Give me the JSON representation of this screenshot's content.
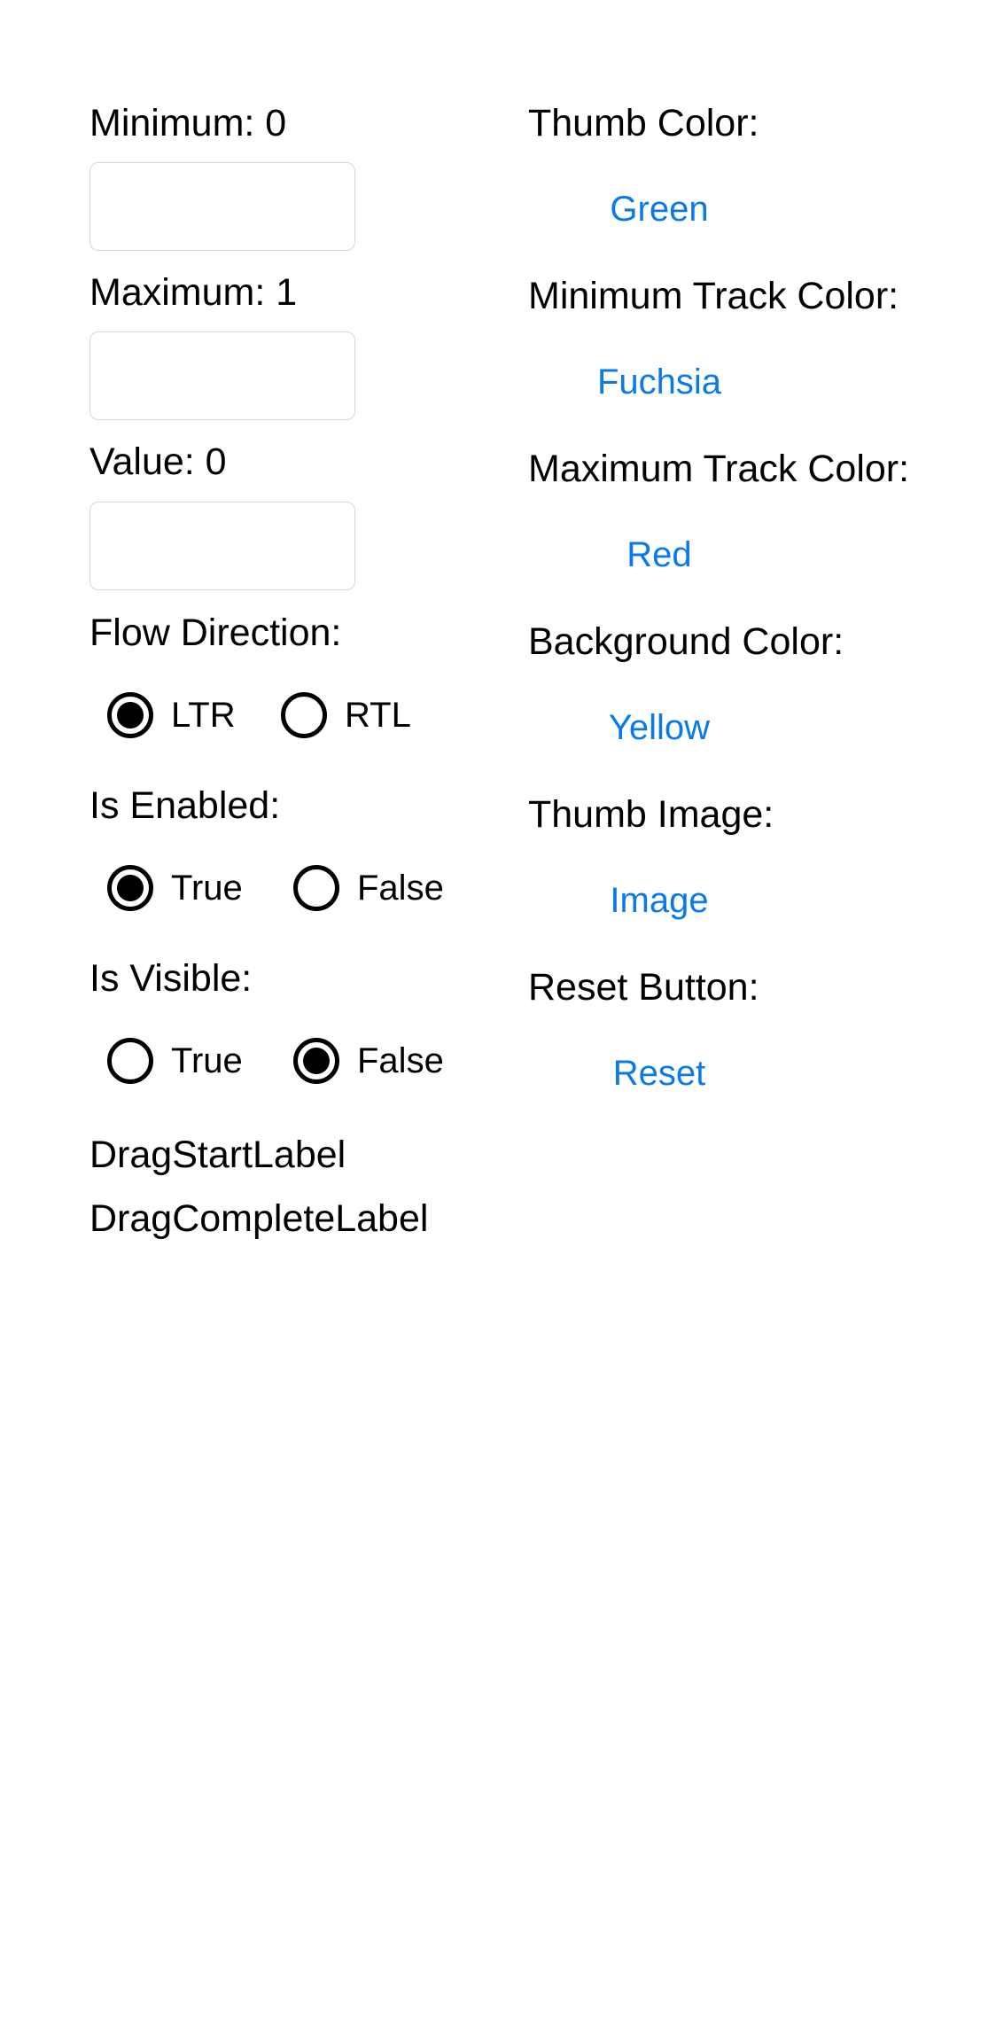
{
  "left": {
    "minimum_label": "Minimum: 0",
    "minimum_value": "",
    "maximum_label": "Maximum: 1",
    "maximum_value": "",
    "value_label": "Value: 0",
    "value_value": "",
    "flow_direction": {
      "label": "Flow Direction:",
      "options": [
        {
          "label": "LTR",
          "checked": true
        },
        {
          "label": "RTL",
          "checked": false
        }
      ]
    },
    "is_enabled": {
      "label": "Is Enabled:",
      "options": [
        {
          "label": "True",
          "checked": true
        },
        {
          "label": "False",
          "checked": false
        }
      ]
    },
    "is_visible": {
      "label": "Is Visible:",
      "options": [
        {
          "label": "True",
          "checked": false
        },
        {
          "label": "False",
          "checked": true
        }
      ]
    },
    "drag_start_label": "DragStartLabel",
    "drag_complete_label": "DragCompleteLabel"
  },
  "right": {
    "thumb_color": {
      "label": "Thumb Color:",
      "button": "Green"
    },
    "minimum_track_color": {
      "label": "Minimum Track Color:",
      "button": "Fuchsia"
    },
    "maximum_track_color": {
      "label": "Maximum Track Color:",
      "button": "Red"
    },
    "background_color": {
      "label": "Background Color:",
      "button": "Yellow"
    },
    "thumb_image": {
      "label": "Thumb Image:",
      "button": "Image"
    },
    "reset_button": {
      "label": "Reset Button:",
      "button": "Reset"
    }
  },
  "colors": {
    "link": "#0a7aea",
    "text": "#000000",
    "field_border": "#d6d6d6",
    "background": "#ffffff"
  }
}
